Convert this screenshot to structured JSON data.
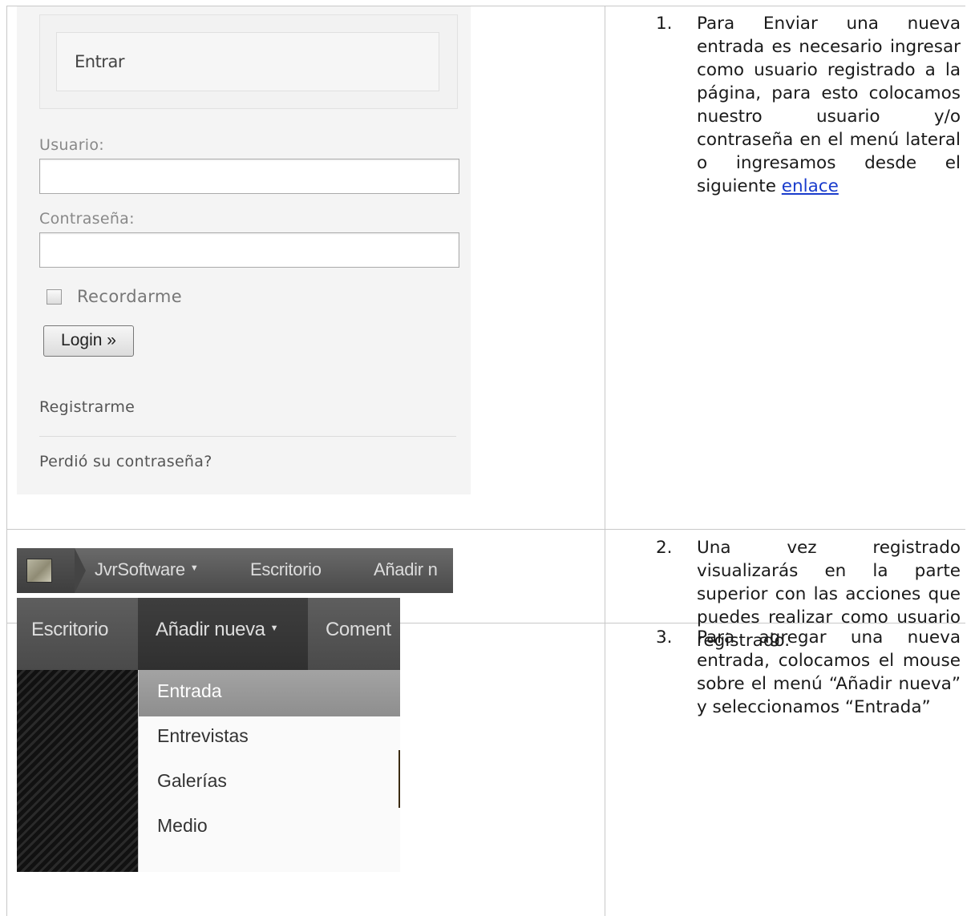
{
  "steps": [
    {
      "number": "1.",
      "text": "Para Enviar una nueva entrada es necesario ingresar como usuario registrado a la página, para esto colocamos nuestro usuario y/o contraseña en el menú lateral o ingresamos desde el siguiente",
      "link": "enlace"
    },
    {
      "number": "2.",
      "text": "Una vez registrado visualizarás en la parte superior con las acciones que puedes realizar como usuario registrado."
    },
    {
      "number": "3.",
      "text": "Para agregar una nueva entrada, colocamos el mouse sobre el menú “Añadir nueva” y seleccionamos “Entrada”"
    }
  ],
  "login": {
    "box_title": "Entrar",
    "user_label": "Usuario:",
    "user_value": "",
    "password_label": "Contraseña:",
    "password_value": "",
    "remember_label": "Recordarme",
    "remember_checked": false,
    "login_button": "Login »",
    "register_link": "Registrarme",
    "lost_password_link": "Perdió su contraseña?"
  },
  "adminbar": {
    "logo_icon": "site-logo-icon",
    "site_name": "JvrSoftware",
    "dashboard": "Escritorio",
    "add_new": "Añadir n"
  },
  "menu": {
    "dashboard": "Escritorio",
    "add_new": "Añadir nueva",
    "comments": "Coment",
    "dropdown": [
      "Entrada",
      "Entrevistas",
      "Galerías",
      "Medio"
    ],
    "highlighted": "Entrada"
  }
}
